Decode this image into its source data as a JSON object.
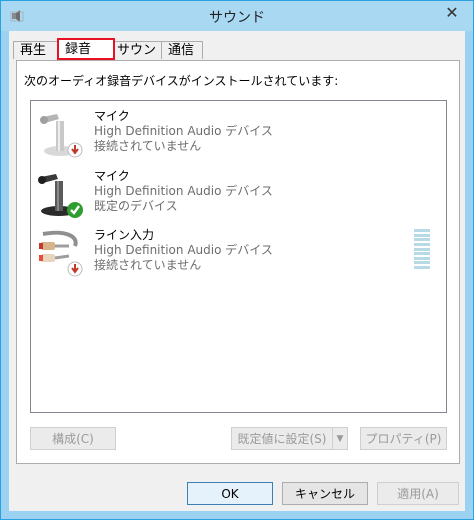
{
  "window": {
    "title": "サウンド",
    "close_glyph": "✕"
  },
  "tabs": [
    {
      "label": "再生"
    },
    {
      "label": "録音"
    },
    {
      "label": "サウンド"
    },
    {
      "label": "通信"
    }
  ],
  "recording": {
    "instruction": "次のオーディオ録音デバイスがインストールされています:",
    "devices": [
      {
        "name": "マイク",
        "description": "High Definition Audio デバイス",
        "status": "接続されていません",
        "icon": "microphone-icon",
        "badge": "down-arrow-badge"
      },
      {
        "name": "マイク",
        "description": "High Definition Audio デバイス",
        "status": "既定のデバイス",
        "icon": "microphone-icon",
        "badge": "checkmark-badge"
      },
      {
        "name": "ライン入力",
        "description": "High Definition Audio デバイス",
        "status": "接続されていません",
        "icon": "line-in-cable-icon",
        "badge": "down-arrow-badge"
      }
    ],
    "buttons": {
      "configure": "構成(C)",
      "set_default": "既定値に設定(S)",
      "properties": "プロパティ(P)"
    }
  },
  "footer": {
    "ok": "OK",
    "cancel": "キャンセル",
    "apply": "適用(A)"
  },
  "colors": {
    "accent": "#2aa1e0",
    "highlight": "#e81123",
    "check": "#2f9d2f",
    "badge": "#c0392b"
  }
}
